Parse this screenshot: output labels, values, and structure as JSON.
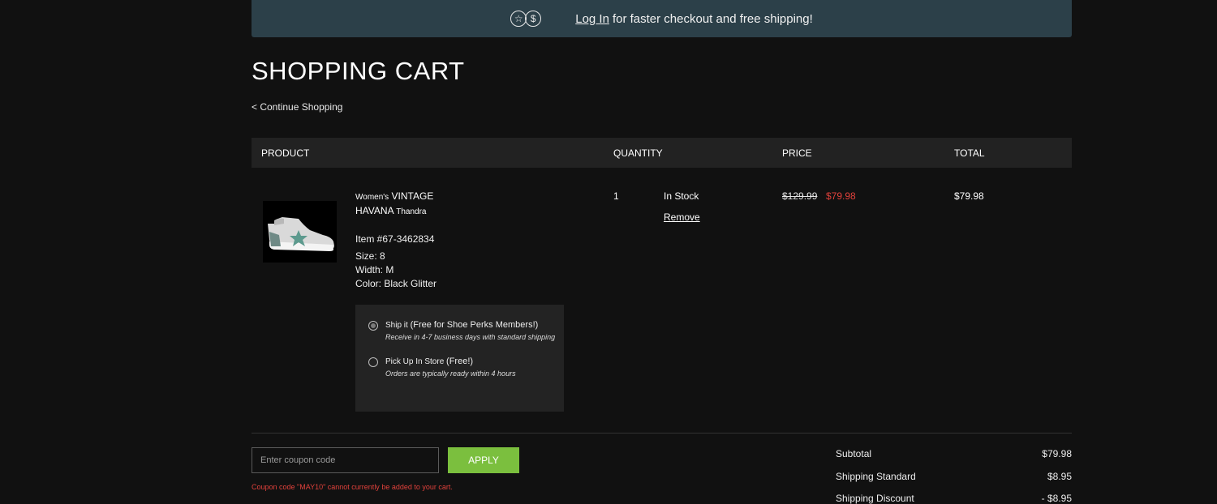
{
  "banner": {
    "star_symbol": "☆",
    "dollar_symbol": "$",
    "login_label": "Log In",
    "text": "for faster checkout and free shipping!"
  },
  "page": {
    "title": "SHOPPING CART",
    "continue_label": "< Continue Shopping"
  },
  "table": {
    "headers": {
      "product": "PRODUCT",
      "quantity": "QUANTITY",
      "price": "PRICE",
      "total": "TOTAL"
    }
  },
  "item": {
    "name_prefix": "Women's",
    "name_bold": "VINTAGE HAVANA",
    "name_suffix": "Thandra",
    "item_number": "Item #67-3462834",
    "size": "Size: 8",
    "width": "Width: M",
    "color": "Color: Black Glitter",
    "quantity": "1",
    "stock_status": "In Stock",
    "remove_label": "Remove",
    "original_price": "$129.99",
    "sale_price": "$79.98",
    "total": "$79.98"
  },
  "shipping_options": {
    "ship": {
      "label": "Ship it",
      "emphasis": "(Free for Shoe Perks Members!)",
      "sub": "Receive in 4-7 business days with standard shipping",
      "selected": true
    },
    "pickup": {
      "label": "Pick Up In Store",
      "emphasis": "(Free!)",
      "sub": "Orders are typically ready within 4 hours",
      "selected": false
    }
  },
  "coupon": {
    "placeholder": "Enter coupon code",
    "value": "",
    "apply_label": "APPLY",
    "error": "Coupon code \"MAY10\" cannot currently be added to your cart."
  },
  "summary": {
    "subtotal_label": "Subtotal",
    "subtotal_value": "$79.98",
    "shipping_label": "Shipping Standard",
    "shipping_value": "$8.95",
    "discount_label": "Shipping Discount",
    "discount_value": "- $8.95"
  },
  "colors": {
    "banner_bg": "#2c4049",
    "sale_red": "#e0413b",
    "apply_green": "#7bbf3e"
  }
}
